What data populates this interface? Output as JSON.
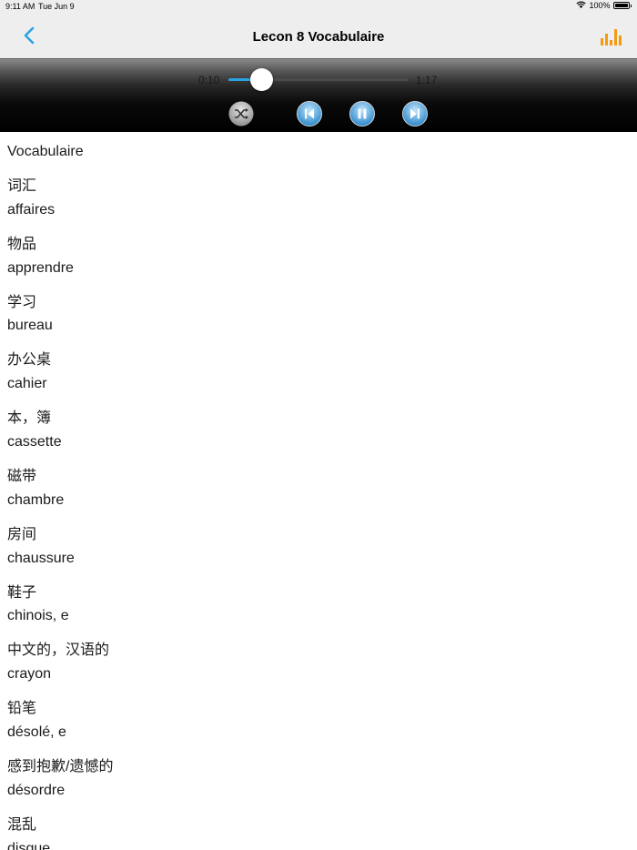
{
  "status": {
    "time": "9:11 AM",
    "date": "Tue Jun 9",
    "battery": "100%"
  },
  "nav": {
    "title": "Lecon 8 Vocabulaire",
    "back_icon": "chevron-left-icon",
    "chart_icon": "bar-chart-icon",
    "accent": "#2aa3e3",
    "chart_color": "#f39c12"
  },
  "player": {
    "current_time": "0:10",
    "total_time": "1:17",
    "progress": 0.18
  },
  "vocab": [
    "Vocabulaire",
    "词汇",
    "affaires",
    "物品",
    "apprendre",
    "学习",
    "bureau",
    "办公桌",
    "cahier",
    "本，簿",
    "cassette",
    "磁带",
    "chambre",
    "房间",
    "chaussure",
    "鞋子",
    "chinois, e",
    "中文的，汉语的",
    "crayon",
    "铅笔",
    "désolé, e",
    "感到抱歉/遗憾的",
    "désordre",
    "混乱",
    "disque"
  ]
}
